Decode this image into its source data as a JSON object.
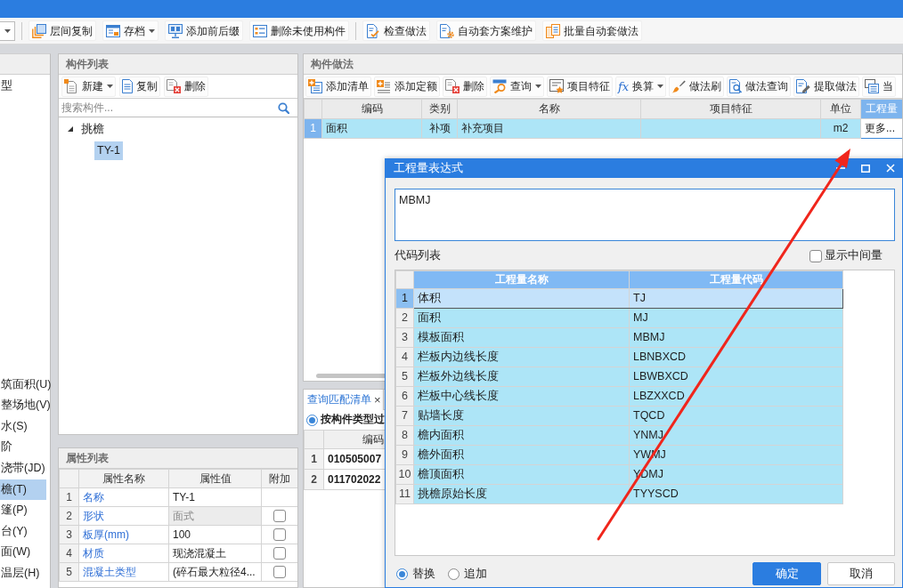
{
  "toolbar": {
    "groups": [
      [
        {
          "label": "层间复制",
          "menu": false
        },
        {
          "label": "存档",
          "menu": true
        },
        {
          "label": "添加前后缀",
          "menu": false
        },
        {
          "label": "删除未使用构件",
          "menu": false
        }
      ],
      [
        {
          "label": "检查做法",
          "menu": false
        },
        {
          "label": "自动套方案维护",
          "menu": false
        },
        {
          "label": "批量自动套做法",
          "menu": false
        }
      ]
    ]
  },
  "category_tree": {
    "groups": [
      [
        {
          "label": "型",
          "selected": false
        }
      ],
      [
        {
          "label": "筑面积(U)",
          "selected": false
        },
        {
          "label": "整场地(V)",
          "selected": false
        },
        {
          "label": "水(S)",
          "selected": false
        },
        {
          "label": "阶",
          "selected": false
        },
        {
          "label": "浇带(JD)",
          "selected": false
        },
        {
          "label": "檐(T)",
          "selected": true
        },
        {
          "label": "篷(P)",
          "selected": false
        },
        {
          "label": "台(Y)",
          "selected": false
        },
        {
          "label": "面(W)",
          "selected": false
        },
        {
          "label": "温层(H)",
          "selected": false
        }
      ]
    ]
  },
  "component_list": {
    "title": "构件列表",
    "actions": [
      {
        "label": "新建",
        "menu": true
      },
      {
        "label": "复制",
        "menu": false
      },
      {
        "label": "删除",
        "menu": false
      }
    ],
    "search": {
      "placeholder": "搜索构件..."
    },
    "tree": [
      {
        "label": "挑檐",
        "expanded": true,
        "selected": false,
        "children": [
          {
            "label": "TY-1",
            "selected": true
          }
        ]
      }
    ]
  },
  "properties": {
    "title": "属性列表",
    "columns": [
      "属性名称",
      "属性值",
      "附加"
    ],
    "rows": [
      {
        "index": "1",
        "name": "名称",
        "value": "TY-1",
        "readonly": false
      },
      {
        "index": "2",
        "name": "形状",
        "value": "面式",
        "readonly": true,
        "attached": false
      },
      {
        "index": "3",
        "name": "板厚(mm)",
        "value": "100",
        "readonly": false,
        "attached": false
      },
      {
        "index": "4",
        "name": "材质",
        "value": "现浇混凝土",
        "readonly": false,
        "attached": false
      },
      {
        "index": "5",
        "name": "混凝土类型",
        "value": "(碎石最大粒径4...",
        "readonly": false,
        "attached": false
      }
    ]
  },
  "methods": {
    "title": "构件做法",
    "actions": [
      {
        "label": "添加清单",
        "menu": false
      },
      {
        "label": "添加定额",
        "menu": false
      },
      {
        "label": "删除",
        "menu": false
      },
      {
        "label": "查询",
        "menu": true
      },
      {
        "label": "项目特征",
        "menu": false
      },
      {
        "label": "换算",
        "symbol": "fx",
        "menu": true
      },
      {
        "label": "做法刷",
        "menu": false
      },
      {
        "label": "做法查询",
        "menu": false
      },
      {
        "label": "提取做法",
        "menu": false
      },
      {
        "label": "当",
        "menu": false
      }
    ],
    "columns": [
      {
        "label": "编码",
        "selected": false
      },
      {
        "label": "类别",
        "selected": false
      },
      {
        "label": "名称",
        "selected": false
      },
      {
        "label": "项目特征",
        "selected": false
      },
      {
        "label": "单位",
        "selected": false
      },
      {
        "label": "工程量",
        "selected": true
      }
    ],
    "rows": [
      {
        "index": "1",
        "selected": true,
        "code": "面积",
        "category": "补项",
        "name": "补充项目",
        "unit": "m2",
        "quantity": "更多..."
      }
    ]
  },
  "match_list": {
    "tab": {
      "label": "查询匹配清单",
      "close": "×"
    },
    "filter": {
      "label": "按构件类型过",
      "selected": true
    },
    "columns": [
      "编码"
    ],
    "rows": [
      {
        "index": "1",
        "code": "010505007"
      },
      {
        "index": "2",
        "code": "011702022"
      }
    ]
  },
  "dialog": {
    "title": "工程量表达式",
    "expression": "MBMJ",
    "list_label": "代码列表",
    "show_intermediate": {
      "label": "显示中间量",
      "checked": false
    },
    "columns": [
      "工程量名称",
      "工程量代码"
    ],
    "rows": [
      {
        "index": "1",
        "name": "体积",
        "code": "TJ",
        "selected": true
      },
      {
        "index": "2",
        "name": "面积",
        "code": "MJ",
        "selected": false
      },
      {
        "index": "3",
        "name": "模板面积",
        "code": "MBMJ",
        "selected": false
      },
      {
        "index": "4",
        "name": "栏板内边线长度",
        "code": "LBNBXCD",
        "selected": false
      },
      {
        "index": "5",
        "name": "栏板外边线长度",
        "code": "LBWBXCD",
        "selected": false
      },
      {
        "index": "6",
        "name": "栏板中心线长度",
        "code": "LBZXXCD",
        "selected": false
      },
      {
        "index": "7",
        "name": "贴墙长度",
        "code": "TQCD",
        "selected": false
      },
      {
        "index": "8",
        "name": "檐内面积",
        "code": "YNMJ",
        "selected": false
      },
      {
        "index": "9",
        "name": "檐外面积",
        "code": "YWMJ",
        "selected": false
      },
      {
        "index": "10",
        "name": "檐顶面积",
        "code": "YDMJ",
        "selected": false
      },
      {
        "index": "11",
        "name": "挑檐原始长度",
        "code": "TYYSCD",
        "selected": false
      }
    ],
    "options": [
      {
        "label": "替换",
        "selected": true
      },
      {
        "label": "追加",
        "selected": false
      }
    ],
    "buttons": [
      {
        "label": "确定",
        "kind": "primary"
      },
      {
        "label": "取消",
        "kind": "default"
      }
    ]
  }
}
